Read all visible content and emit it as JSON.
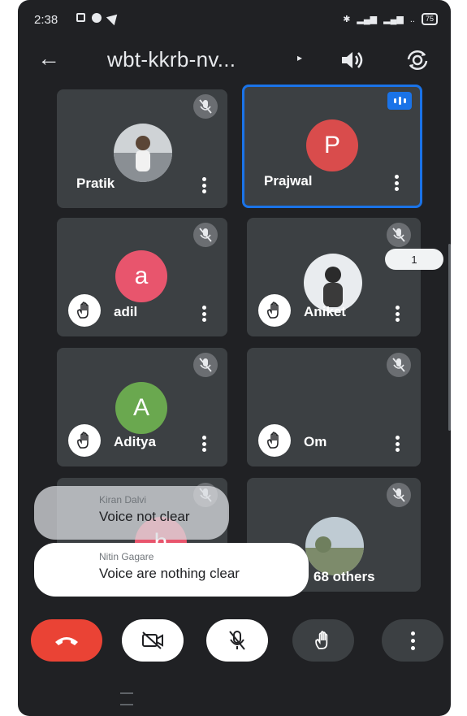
{
  "status_bar": {
    "time": "2:38",
    "battery": "75"
  },
  "header": {
    "title": "wbt-kkrb-nv...",
    "caret": "▸"
  },
  "participants": [
    {
      "name": "Pratik"
    },
    {
      "name": "Prajwal",
      "letter": "P"
    },
    {
      "name": "adil",
      "letter": "a"
    },
    {
      "name": "Aniket"
    },
    {
      "name": "Aditya",
      "letter": "A"
    },
    {
      "name": "Om"
    }
  ],
  "side_count": "1",
  "others": {
    "label": "68 others"
  },
  "hidden_tile": {
    "letter": "h"
  },
  "chat": [
    {
      "sender": "Kiran Dalvi",
      "message": "Voice  not clear"
    },
    {
      "sender": "Nitin Gagare",
      "message": "Voice are nothing clear"
    }
  ],
  "colors": {
    "accent": "#1a73e8",
    "end_call": "#ea4335",
    "avatar_pink": "#e8556d",
    "avatar_green": "#6aa84f",
    "avatar_red": "#d94c4c"
  }
}
